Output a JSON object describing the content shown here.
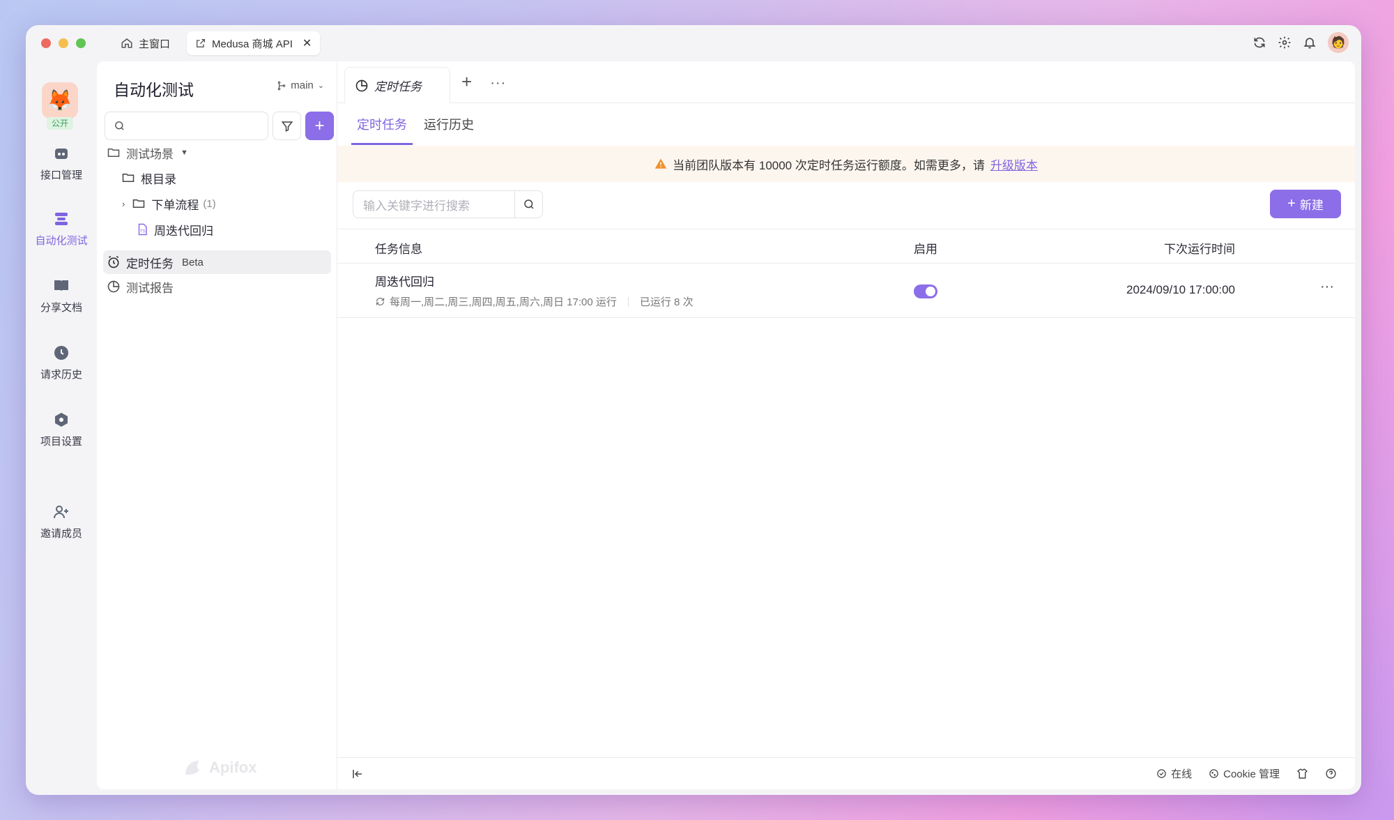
{
  "window": {
    "traffic_colors": [
      "#ed6a5e",
      "#f5bf4f",
      "#61c554"
    ],
    "tabs": [
      {
        "label": "主窗口",
        "icon": "home-icon"
      },
      {
        "label": "Medusa 商城 API",
        "icon": "external-link-icon"
      }
    ]
  },
  "rail": {
    "project_badge": "公开",
    "items": [
      {
        "label": "接口管理",
        "icon": "api-icon"
      },
      {
        "label": "自动化测试",
        "icon": "automation-icon"
      },
      {
        "label": "分享文档",
        "icon": "book-icon"
      },
      {
        "label": "请求历史",
        "icon": "clock-icon"
      },
      {
        "label": "项目设置",
        "icon": "settings-hex-icon"
      },
      {
        "label": "邀请成员",
        "icon": "add-user-icon"
      }
    ]
  },
  "sidebar": {
    "title": "自动化测试",
    "branch": "main",
    "tree": [
      {
        "label": "测试场景"
      },
      {
        "label": "根目录"
      },
      {
        "label": "下单流程",
        "count": "(1)"
      },
      {
        "label": "周迭代回归"
      },
      {
        "label": "定时任务",
        "badge": "Beta"
      },
      {
        "label": "测试报告"
      }
    ],
    "watermark": "Apifox"
  },
  "main": {
    "doc_tab": "定时任务",
    "sub_tabs": [
      "定时任务",
      "运行历史"
    ],
    "notice_text": "当前团队版本有 10000 次定时任务运行额度。如需更多，请",
    "notice_link": "升级版本",
    "search_placeholder": "输入关键字进行搜索",
    "new_button": "新建",
    "columns": {
      "info": "任务信息",
      "enabled": "启用",
      "next_run": "下次运行时间"
    },
    "rows": [
      {
        "title": "周迭代回归",
        "schedule": "每周一,周二,周三,周四,周五,周六,周日 17:00 运行",
        "run_count": "已运行 8 次",
        "enabled": true,
        "next_run": "2024/09/10 17:00:00"
      }
    ]
  },
  "footer": {
    "online": "在线",
    "cookie": "Cookie 管理"
  },
  "colors": {
    "accent": "#8b6ee8",
    "notice_bg": "#fdf6ee",
    "warning": "#f0902e"
  }
}
